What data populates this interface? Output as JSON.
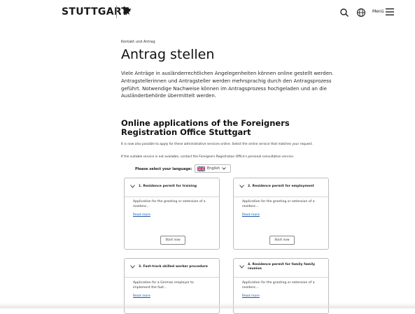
{
  "header": {
    "logo_text": "STUTTGART",
    "menu_label": "Menü",
    "icons": [
      "search-icon",
      "globe-icon",
      "hamburger-menu-icon",
      "horse-logo-icon"
    ]
  },
  "breadcrumb": "Kontakt und Antrag",
  "page_title": "Antrag stellen",
  "intro_text": "Viele Anträge in ausländerrechtlichen Angelegenheiten können online gestellt werden. Antragstellerinnen und Antragsteller werden mehrsprachig durch den Antragsprozess geführt. Notwendige Nachweise können im Antragsprozess hochgeladen und an die Ausländerbehörde übermittelt werden.",
  "online_apps": {
    "title": "Online applications of the Foreigners Registration Office Stuttgart",
    "para1": "It is now also possible to apply for these administrative services online. Select the online service that matches your request.",
    "para2": "If the suitable service is not available, contact the Foreigners Registration Office's personal consultation service.",
    "language_label": "Please select your language:",
    "language_selected": "English"
  },
  "cards": [
    {
      "title": "1. Residence permit for training",
      "desc": "Application for the granting or extension of a residenc...",
      "link": "Read more",
      "button": "Start now"
    },
    {
      "title": "2. Residence permit for employment",
      "desc": "Application for the granting or extension of a residenc...",
      "link": "Read more",
      "button": "Start now"
    },
    {
      "title": "3. Fast-track skilled worker procedure",
      "desc": "Application for a German employer to implement the fast...",
      "link": "Read more"
    },
    {
      "title": "4. Residence permit for family family reunion",
      "desc": "Application for the granting or extension of a residenc...",
      "link": "Read more"
    }
  ],
  "colors": {
    "link": "#1a57a6",
    "text": "#1a1a1a",
    "border": "#bdbdbd"
  }
}
